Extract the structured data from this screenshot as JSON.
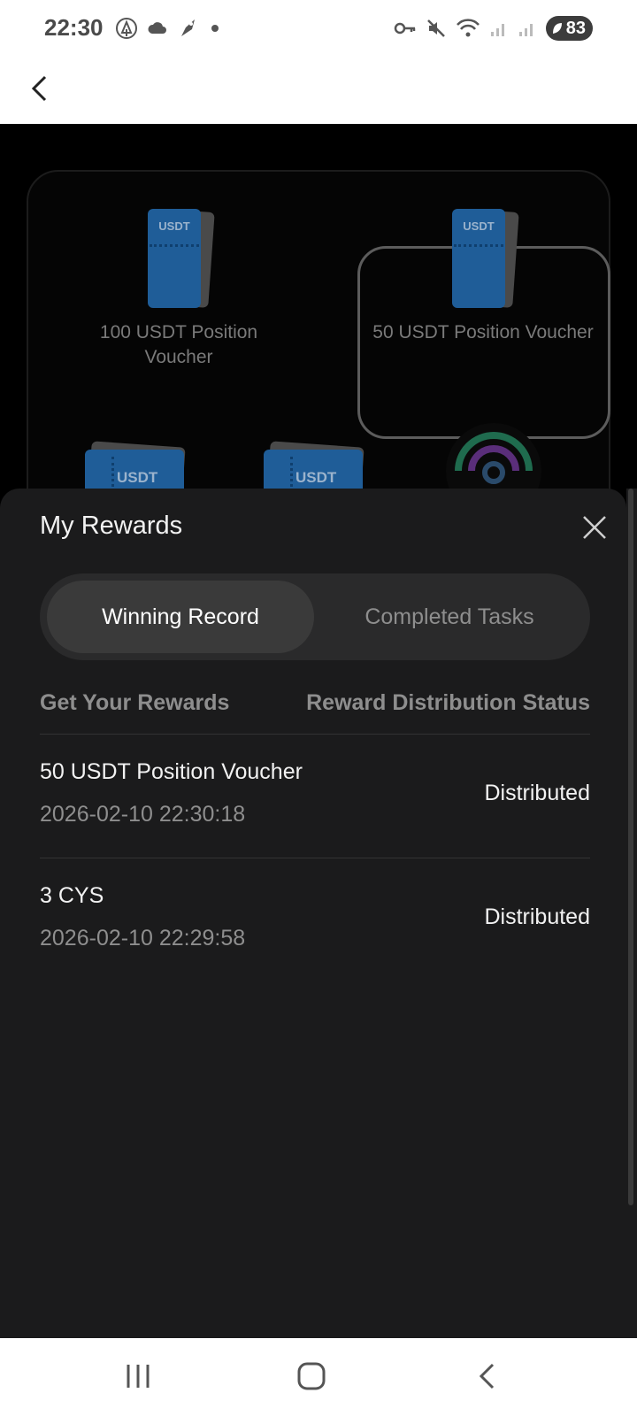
{
  "status_bar": {
    "time": "22:30",
    "battery": "83",
    "left_icons": [
      "tree-icon",
      "cloud-icon",
      "rocket-icon",
      "dot-icon"
    ],
    "right_icons": [
      "key-icon",
      "mute-icon",
      "wifi-icon",
      "signal-icon",
      "signal-icon",
      "battery-icon"
    ]
  },
  "background": {
    "vouchers": [
      {
        "label": "100 USDT Position Voucher",
        "ticket_text": "USDT"
      },
      {
        "label": "50 USDT Position Voucher",
        "ticket_text": "USDT"
      }
    ],
    "row2_tickets": [
      "USDT",
      "USDT"
    ]
  },
  "sheet": {
    "title": "My Rewards",
    "tabs": [
      {
        "label": "Winning Record",
        "active": true
      },
      {
        "label": "Completed Tasks",
        "active": false
      }
    ],
    "columns": {
      "left": "Get Your Rewards",
      "right": "Reward Distribution Status"
    },
    "rows": [
      {
        "title": "50 USDT Position Voucher",
        "time": "2026-02-10 22:30:18",
        "status": "Distributed"
      },
      {
        "title": "3 CYS",
        "time": "2026-02-10 22:29:58",
        "status": "Distributed"
      }
    ]
  },
  "colors": {
    "sheet_bg": "#1b1b1c",
    "tab_active_bg": "#3a3a3a",
    "ticket_blue": "#1f5d98",
    "muted_text": "#8e8e8e"
  }
}
